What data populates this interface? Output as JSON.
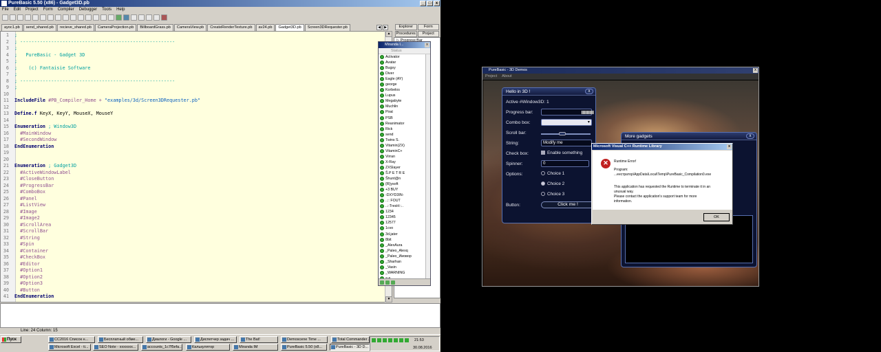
{
  "ide": {
    "title": "PureBasic 5.50 (x86) - Gadget3D.pb",
    "menu": [
      "File",
      "Edit",
      "Project",
      "Form",
      "Compiler",
      "Debugger",
      "Tools",
      "Help"
    ],
    "tabs": [
      "ayoc1.pb",
      "send_shared.pb",
      "recieve_shared.pb",
      "CameraProjection.pb",
      "BillboardGrass.pb",
      "CameraView.pb",
      "CreateRenderTexture.pb",
      "av24.pb",
      "Gadget3D.pb",
      "Screen3DRequester.pb"
    ],
    "active_tab": "Gadget3D.pb",
    "panel_tabs": [
      "Explorer",
      "Form",
      "Procedures",
      "Project"
    ],
    "procedure_item": "Progress:Bar",
    "status": "Line: 24   Column: 15"
  },
  "code": [
    {
      "n": "1",
      "t": ";",
      "c": "cm"
    },
    {
      "n": "2",
      "t": "; -------------------------------------------------------",
      "c": "cm"
    },
    {
      "n": "3",
      "t": ";",
      "c": "cm"
    },
    {
      "n": "4",
      "t": ";   PureBasic - Gadget 3D",
      "c": "cm"
    },
    {
      "n": "5",
      "t": ";",
      "c": "cm"
    },
    {
      "n": "6",
      "t": ";    (c) Fantaisie Software",
      "c": "cm"
    },
    {
      "n": "7",
      "t": ";",
      "c": "cm"
    },
    {
      "n": "8",
      "t": "; -------------------------------------------------------",
      "c": "cm"
    },
    {
      "n": "9",
      "t": ";",
      "c": "cm"
    },
    {
      "n": "10",
      "t": "",
      "c": "tx"
    },
    {
      "n": "11",
      "t": "IncludeFile #PB_Compiler_Home + \"examples/3d/Screen3DRequester.pb\"",
      "c": "mix1"
    },
    {
      "n": "12",
      "t": "",
      "c": "tx"
    },
    {
      "n": "13",
      "t": "Define.f KeyX, KeyY, MouseX, MouseY",
      "c": "mix2"
    },
    {
      "n": "14",
      "t": "",
      "c": "tx"
    },
    {
      "n": "15",
      "t": "Enumeration ; Window3D",
      "c": "mix3"
    },
    {
      "n": "16",
      "t": "  #MainWindow",
      "c": "cn"
    },
    {
      "n": "17",
      "t": "  #SecondWindow",
      "c": "cn"
    },
    {
      "n": "18",
      "t": "EndEnumeration",
      "c": "kw"
    },
    {
      "n": "19",
      "t": "",
      "c": "tx"
    },
    {
      "n": "20",
      "t": "",
      "c": "tx"
    },
    {
      "n": "21",
      "t": "Enumeration ; Gadget3D",
      "c": "mix3"
    },
    {
      "n": "22",
      "t": "  #ActiveWindowLabel",
      "c": "cn"
    },
    {
      "n": "23",
      "t": "  #CloseButton",
      "c": "cn"
    },
    {
      "n": "24",
      "t": "  #ProgressBar",
      "c": "cn"
    },
    {
      "n": "25",
      "t": "  #ComboBox",
      "c": "cn"
    },
    {
      "n": "26",
      "t": "  #Panel",
      "c": "cn"
    },
    {
      "n": "27",
      "t": "  #ListView",
      "c": "cn"
    },
    {
      "n": "28",
      "t": "  #Image",
      "c": "cn"
    },
    {
      "n": "29",
      "t": "  #Image2",
      "c": "cn"
    },
    {
      "n": "30",
      "t": "  #ScrollArea",
      "c": "cn"
    },
    {
      "n": "31",
      "t": "  #ScrollBar",
      "c": "cn"
    },
    {
      "n": "32",
      "t": "  #String",
      "c": "cn"
    },
    {
      "n": "33",
      "t": "  #Spin",
      "c": "cn"
    },
    {
      "n": "34",
      "t": "  #Container",
      "c": "cn"
    },
    {
      "n": "35",
      "t": "  #CheckBox",
      "c": "cn"
    },
    {
      "n": "36",
      "t": "  #Editor",
      "c": "cn"
    },
    {
      "n": "37",
      "t": "  #Option1",
      "c": "cn"
    },
    {
      "n": "38",
      "t": "  #Option2",
      "c": "cn"
    },
    {
      "n": "39",
      "t": "  #Option3",
      "c": "cn"
    },
    {
      "n": "40",
      "t": "  #Button",
      "c": "cn"
    },
    {
      "n": "41",
      "t": "EndEnumeration",
      "c": "kw"
    }
  ],
  "miranda": {
    "title": "Miranda I...",
    "status": "Status",
    "contacts": [
      "Activator",
      "Avatar",
      "Bugsy",
      "Diver",
      "Eagle (AY)",
      "george",
      "Korbelos",
      "Lupus",
      "Megabyte",
      "Muchlin",
      "Pirat",
      "PSB",
      "Reanimator",
      "Rick",
      "send",
      "Twins S.",
      "Vitamin(ZX)",
      "VitaminC+",
      "Virran",
      "X-Ray",
      "ZXSlayer",
      "Š.P E T R E",
      "Šhunt@n",
      "{R}ysoft",
      "+3 BUY",
      "-DXYD3IN-",
      "..:: FOUT",
      "..::TresH::..",
      "1234",
      "12345",
      "12577",
      "1cvo",
      "3d.jater",
      "8bit",
      "_AlexAura",
      "_Paleo_Alexq",
      "_Paleo_Ииовор",
      "_Sharhan",
      "_Vasin",
      "_WARNING",
      "a.e"
    ]
  },
  "demo": {
    "title": "PureBasic - 3D Demos",
    "menu": [
      "Project",
      "About"
    ],
    "hello": {
      "title": "Hello in 3D !",
      "close": "x",
      "active": "Active #Window3D: 1",
      "progress_label": "Progress bar:",
      "progress_value": 0.25,
      "combo_label": "Combo box:",
      "scroll_label": "Scroll bar:",
      "string_label": "String:",
      "string_value": "Modify me",
      "check_label": "Check box:",
      "check_text": "Enable something",
      "spinner_label": "Spinner:",
      "spinner_value": "0",
      "options_label": "Options:",
      "choice1": "Choice 1",
      "choice2": "Choice 2",
      "choice3": "Choice 3",
      "button_label": "Button:",
      "button_text": "Click me !"
    },
    "more": {
      "title": "More gadgets",
      "close": "x"
    }
  },
  "error": {
    "title": "Microsoft Visual C++ Runtime Library",
    "heading": "Runtime Error!",
    "program_label": "Program:",
    "program": "...еестратор\\AppData\\Local\\Temp\\PureBasic_Compilation0.exe",
    "msg1": "This application has requested the Runtime to terminate it in an",
    "msg2": "unusual way.",
    "msg3": "Please contact the application's support team for more",
    "msg4": "information.",
    "ok": "OK"
  },
  "taskbar": {
    "start": "Пуск",
    "row1": [
      "CC2016 Список н...",
      "Бесплатный обме...",
      "Диалоги - Google ...",
      "Диспетчер задач ...",
      "The Bat!",
      "Demoscene Time ...",
      "Total Commander ..."
    ],
    "row2": [
      "Microsoft Excel - ti...",
      "SEO Note - xxxxxxx...",
      "accounts_1c7f5efa...",
      "Калькулятор",
      "Miranda IM",
      "PureBasic 5.50 (x8...",
      "PureBasic - 3D D..."
    ],
    "time": "21:53",
    "date": "30.08.2016"
  }
}
